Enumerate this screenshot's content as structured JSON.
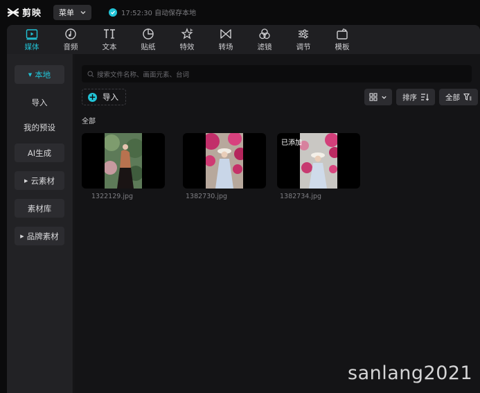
{
  "app": {
    "name": "剪映"
  },
  "menu": {
    "label": "菜单"
  },
  "autosave": {
    "text": "17:52:30 自动保存本地"
  },
  "tabs": [
    {
      "label": "媒体",
      "icon": "media-icon",
      "active": true
    },
    {
      "label": "音频",
      "icon": "audio-icon",
      "active": false
    },
    {
      "label": "文本",
      "icon": "text-icon",
      "active": false
    },
    {
      "label": "贴纸",
      "icon": "sticker-icon",
      "active": false
    },
    {
      "label": "特效",
      "icon": "effects-icon",
      "active": false
    },
    {
      "label": "转场",
      "icon": "transition-icon",
      "active": false
    },
    {
      "label": "滤镜",
      "icon": "filter-icon",
      "active": false
    },
    {
      "label": "调节",
      "icon": "adjust-icon",
      "active": false
    },
    {
      "label": "模板",
      "icon": "template-icon",
      "active": false
    }
  ],
  "sidebar": {
    "items": [
      {
        "label": "本地",
        "expanded": true
      },
      {
        "label": "导入"
      },
      {
        "label": "我的预设"
      },
      {
        "label": "AI生成"
      },
      {
        "label": "云素材"
      },
      {
        "label": "素材库"
      },
      {
        "label": "品牌素材"
      }
    ]
  },
  "search": {
    "placeholder": "搜索文件名称、画面元素、台词"
  },
  "toolbar": {
    "import_label": "导入",
    "sort_label": "排序",
    "filter_label": "全部"
  },
  "section": {
    "label": "全部"
  },
  "media": [
    {
      "filename": "1322129.jpg",
      "added": ""
    },
    {
      "filename": "1382730.jpg",
      "added": ""
    },
    {
      "filename": "1382734.jpg",
      "added": "已添加"
    }
  ],
  "watermark": "sanlang2021",
  "colors": {
    "accent": "#22c3d6",
    "background": "#141416",
    "sidebar": "#222225"
  }
}
